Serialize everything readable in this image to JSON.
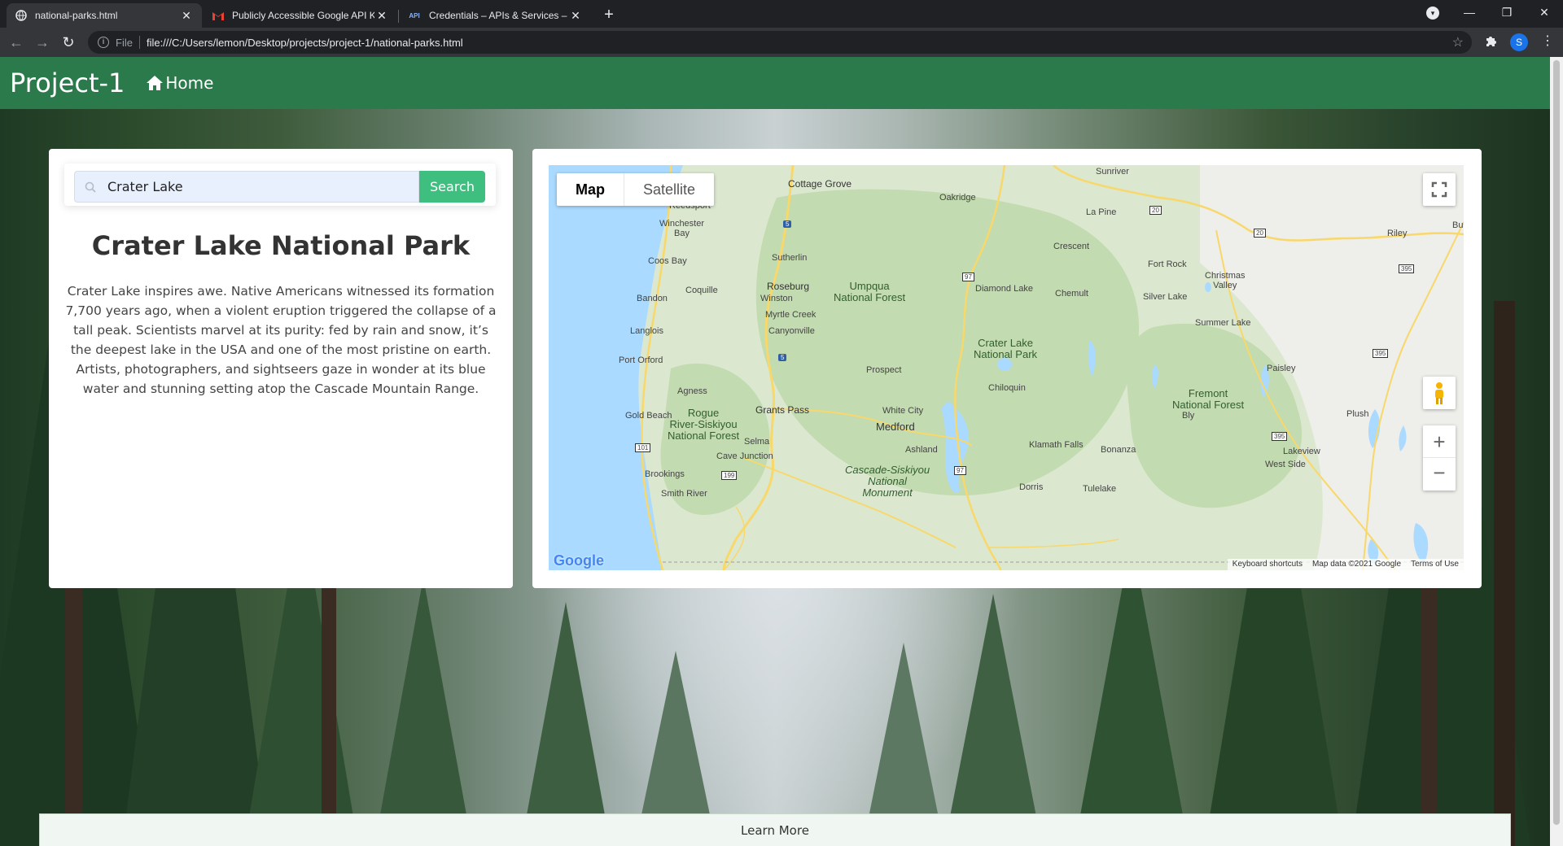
{
  "browser": {
    "tabs": [
      {
        "title": "national-parks.html",
        "favicon": "globe-icon",
        "active": true
      },
      {
        "title": "Publicly Accessible Google API K",
        "favicon": "gmail-icon",
        "active": false
      },
      {
        "title": "Credentials – APIs & Services – M",
        "favicon": "api-icon",
        "favicon_text": "API",
        "active": false
      }
    ],
    "url_scheme": "File",
    "url": "file:///C:/Users/lemon/Desktop/projects/project-1/national-parks.html",
    "profile_initial": "S"
  },
  "navbar": {
    "brand": "Project-1",
    "home_label": "Home",
    "color": "#2b7a4b"
  },
  "search": {
    "value": "Crater Lake",
    "button_label": "Search"
  },
  "park": {
    "title": "Crater Lake National Park",
    "description": "Crater Lake inspires awe. Native Americans witnessed its formation 7,700 years ago, when a violent eruption triggered the collapse of a tall peak. Scientists marvel at its purity: fed by rain and snow, it’s the deepest lake in the USA and one of the most pristine on earth. Artists, photographers, and sightseers gaze in wonder at its blue water and stunning setting atop the Cascade Mountain Range."
  },
  "map": {
    "type_buttons": [
      "Map",
      "Satellite"
    ],
    "selected_type": "Map",
    "footer": [
      "Keyboard shortcuts",
      "Map data ©2021 Google",
      "Terms of Use"
    ],
    "logo": "Google",
    "labels": {
      "cottage_grove": "Cottage Grove",
      "sunriver": "Sunriver",
      "reedsport": "Reedsport",
      "oakridge": "Oakridge",
      "winchester_bay": "Winchester\nBay",
      "la_pine": "La Pine",
      "sutherlin": "Sutherlin",
      "crescent": "Crescent",
      "fort_rock": "Fort Rock",
      "riley": "Riley",
      "coos_bay": "Coos Bay",
      "christmas_valley": "Christmas\nValley",
      "roseburg": "Roseburg",
      "coquille": "Coquille",
      "umpqua": "Umpqua\nNational Forest",
      "diamond_lake": "Diamond Lake",
      "chemult": "Chemult",
      "bandon": "Bandon",
      "winston": "Winston",
      "silver_lake": "Silver Lake",
      "myrtle_creek": "Myrtle Creek",
      "summer_lake": "Summer Lake",
      "canyonville": "Canyonville",
      "langlois": "Langlois",
      "crater_lake": "Crater Lake\nNational Park",
      "port_orford": "Port Orford",
      "prospect": "Prospect",
      "paisley": "Paisley",
      "agness": "Agness",
      "chiloquin": "Chiloquin",
      "fremont": "Fremont\nNational Forest",
      "rogue": "Rogue\nRiver-Siskiyou\nNational Forest",
      "grants_pass": "Grants Pass",
      "white_city": "White City",
      "gold_beach": "Gold Beach",
      "medford": "Medford",
      "plush": "Plush",
      "bly": "Bly",
      "selma": "Selma",
      "klamath_falls": "Klamath Falls",
      "ashland": "Ashland",
      "bonanza": "Bonanza",
      "lakeview": "Lakeview",
      "cave_junction": "Cave Junction",
      "cascade_siskiyou": "Cascade-Siskiyou\nNational\nMonument",
      "west_side": "West Side",
      "brookings": "Brookings",
      "dorris": "Dorris",
      "tulelake": "Tulelake",
      "smith_river": "Smith River",
      "bu": "Bu"
    },
    "shields": {
      "i5a": "5",
      "i5b": "5",
      "us97a": "97",
      "us97b": "97",
      "us20a": "20",
      "us20b": "20",
      "us395a": "395",
      "us395b": "395",
      "us395c": "395",
      "us101": "101",
      "us199": "199"
    }
  },
  "learn_more_label": "Learn More"
}
